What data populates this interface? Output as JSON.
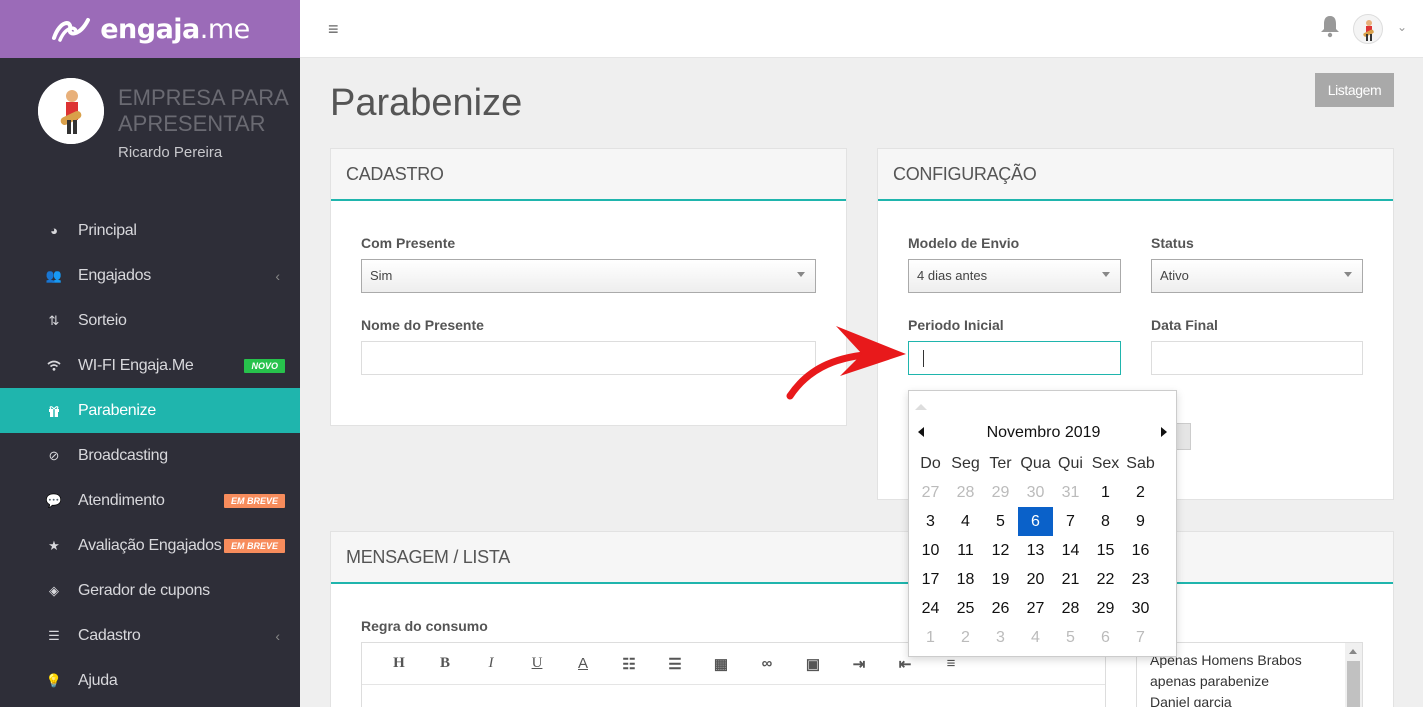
{
  "brand": {
    "name_bold": "engaja",
    "name_light": ".me"
  },
  "profile": {
    "company": "EMPRESA PARA APRESENTAR",
    "user": "Ricardo Pereira"
  },
  "menu": [
    {
      "label": "Principal",
      "icon": "dashboard-icon"
    },
    {
      "label": "Engajados",
      "icon": "users-icon",
      "caret": "‹"
    },
    {
      "label": "Sorteio",
      "icon": "sort-icon"
    },
    {
      "label": "WI-FI Engaja.Me",
      "icon": "wifi-icon",
      "badge": "NOVO"
    },
    {
      "label": "Parabenize",
      "icon": "gift-icon"
    },
    {
      "label": "Broadcasting",
      "icon": "compass-icon"
    },
    {
      "label": "Atendimento",
      "icon": "chat-icon",
      "badge": "EM BREVE"
    },
    {
      "label": "Avaliação Engajados",
      "icon": "star-icon",
      "badge": "EM BREVE"
    },
    {
      "label": "Gerador de cupons",
      "icon": "ticket-icon"
    },
    {
      "label": "Cadastro",
      "icon": "sliders-icon",
      "caret": "‹"
    },
    {
      "label": "Ajuda",
      "icon": "lightbulb-icon"
    }
  ],
  "page": {
    "title": "Parabenize",
    "listagem": "Listagem"
  },
  "cadastro": {
    "title": "CADASTRO",
    "com_presente_label": "Com Presente",
    "com_presente_value": "Sim",
    "nome_presente_label": "Nome do Presente",
    "nome_presente_value": ""
  },
  "configuracao": {
    "title": "CONFIGURAÇÃO",
    "modelo_label": "Modelo de Envio",
    "modelo_value": "4 dias antes",
    "status_label": "Status",
    "status_value": "Ativo",
    "periodo_label": "Periodo Inicial",
    "periodo_value": "",
    "data_final_label": "Data Final",
    "data_final_value": ""
  },
  "datepicker": {
    "title": "Novembro 2019",
    "weekdays": [
      "Do",
      "Seg",
      "Ter",
      "Qua",
      "Qui",
      "Sex",
      "Sab"
    ],
    "weeks": [
      [
        "27",
        "28",
        "29",
        "30",
        "31",
        "1",
        "2"
      ],
      [
        "3",
        "4",
        "5",
        "6",
        "7",
        "8",
        "9"
      ],
      [
        "10",
        "11",
        "12",
        "13",
        "14",
        "15",
        "16"
      ],
      [
        "17",
        "18",
        "19",
        "20",
        "21",
        "22",
        "23"
      ],
      [
        "24",
        "25",
        "26",
        "27",
        "28",
        "29",
        "30"
      ],
      [
        "1",
        "2",
        "3",
        "4",
        "5",
        "6",
        "7"
      ]
    ],
    "selected": "6"
  },
  "mensagem": {
    "title": "MENSAGEM / LISTA",
    "regra_label": "Regra do consumo",
    "toolbar": [
      "H",
      "B",
      "I",
      "U",
      "A",
      "ordered-list-icon",
      "unordered-list-icon",
      "table-icon",
      "link-icon",
      "image-icon",
      "indent-icon",
      "outdent-icon",
      "align-icon"
    ],
    "list_items": [
      "Apenas Homens Brabos",
      "apenas parabenize",
      "Daniel garcia"
    ]
  },
  "colors": {
    "brand": "#9b6bb8",
    "sidebar": "#2e2e38",
    "accent": "#1fb5ad",
    "selected_day": "#0a61c9",
    "badge_new": "#27c24c",
    "badge_soon": "#f78c5c"
  }
}
